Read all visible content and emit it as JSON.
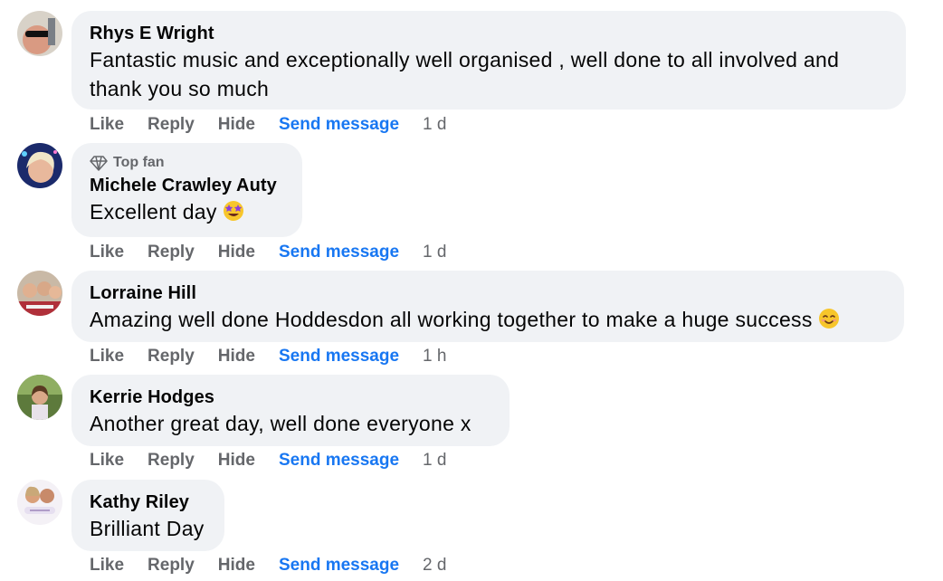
{
  "comments": [
    {
      "author": "Rhys E Wright",
      "text": "Fantastic music and exceptionally well organised , well done to all involved and thank you so much",
      "actions": {
        "like": "Like",
        "reply": "Reply",
        "hide": "Hide",
        "send": "Send message",
        "time": "1 d"
      }
    },
    {
      "badge": "Top fan",
      "author": "Michele Crawley Auty",
      "text": "Excellent day",
      "emoji": "star-struck-emoji",
      "actions": {
        "like": "Like",
        "reply": "Reply",
        "hide": "Hide",
        "send": "Send message",
        "time": "1 d"
      }
    },
    {
      "author": "Lorraine Hill",
      "text": "Amazing well done Hoddesdon all working together to make a huge success",
      "emoji": "smiling-face-emoji",
      "actions": {
        "like": "Like",
        "reply": "Reply",
        "hide": "Hide",
        "send": "Send message",
        "time": "1 h"
      }
    },
    {
      "author": "Kerrie Hodges",
      "text": "Another great day, well done everyone x",
      "actions": {
        "like": "Like",
        "reply": "Reply",
        "hide": "Hide",
        "send": "Send message",
        "time": "1 d"
      }
    },
    {
      "author": "Kathy Riley",
      "text": "Brilliant Day",
      "actions": {
        "like": "Like",
        "reply": "Reply",
        "hide": "Hide",
        "send": "Send message",
        "time": "2 d"
      }
    }
  ],
  "colors": {
    "bubble": "#f0f2f5",
    "link": "#1877f2",
    "muted": "#65676b"
  }
}
